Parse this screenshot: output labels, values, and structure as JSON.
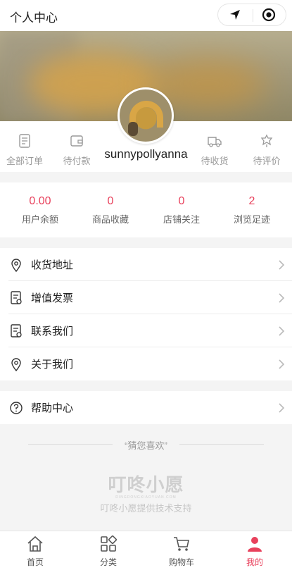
{
  "header": {
    "title": "个人中心"
  },
  "user": {
    "name": "sunnypollyanna"
  },
  "orders": [
    {
      "label": "全部订单",
      "icon": "document-icon"
    },
    {
      "label": "待付款",
      "icon": "wallet-icon"
    },
    {
      "label": "待收货",
      "icon": "truck-icon"
    },
    {
      "label": "待评价",
      "icon": "comment-icon"
    }
  ],
  "stats": [
    {
      "value": "0.00",
      "label": "用户余额"
    },
    {
      "value": "0",
      "label": "商品收藏"
    },
    {
      "value": "0",
      "label": "店铺关注"
    },
    {
      "value": "2",
      "label": "浏览足迹"
    }
  ],
  "menu": [
    {
      "label": "收货地址",
      "icon": "location-icon"
    },
    {
      "label": "增值发票",
      "icon": "invoice-icon"
    },
    {
      "label": "联系我们",
      "icon": "contact-icon"
    },
    {
      "label": "关于我们",
      "icon": "location-icon"
    }
  ],
  "help": {
    "label": "帮助中心",
    "icon": "question-icon"
  },
  "guess": {
    "label": "“猜您喜欢”"
  },
  "footer_logo": {
    "text": "叮咚小愿",
    "sub": "DINGDONGXIAOYUAN.COM"
  },
  "support": "叮咚小愿提供技术支持",
  "tabs": [
    {
      "label": "首页",
      "icon": "home-icon"
    },
    {
      "label": "分类",
      "icon": "category-icon"
    },
    {
      "label": "购物车",
      "icon": "cart-icon"
    },
    {
      "label": "我的",
      "icon": "user-icon"
    }
  ],
  "colors": {
    "accent": "#e8415c",
    "text": "#222222",
    "muted": "#999999"
  }
}
